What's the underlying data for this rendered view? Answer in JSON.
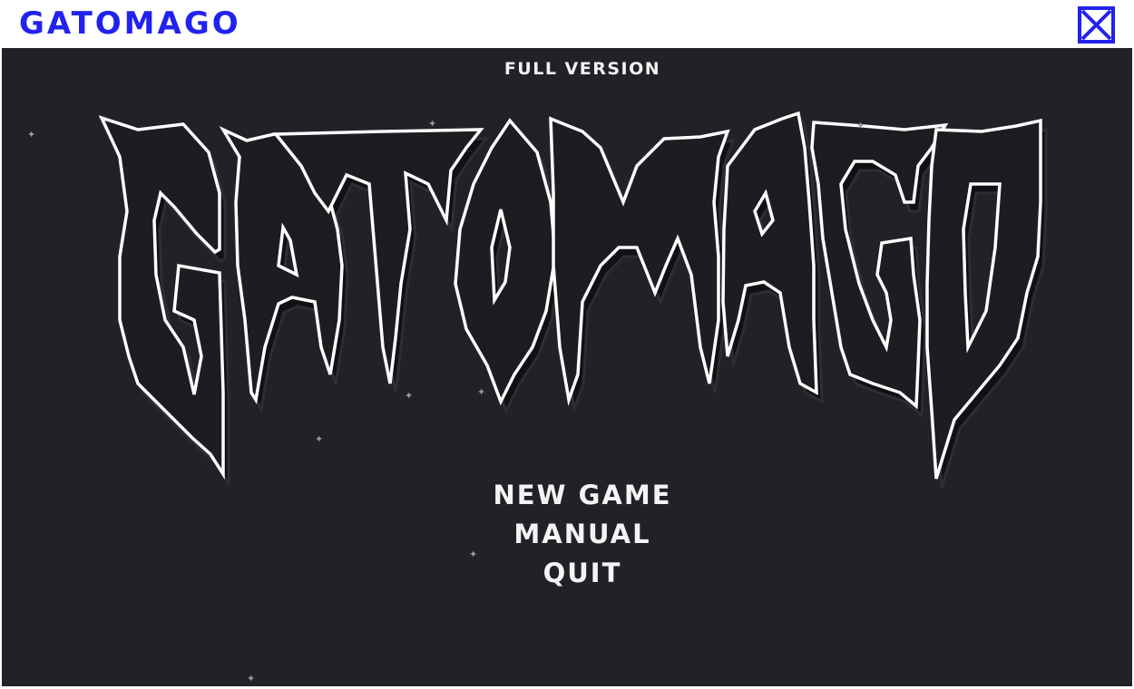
{
  "window": {
    "title": "GATOMAGO",
    "close_icon": "close-icon",
    "accent_color": "#2222ee"
  },
  "game": {
    "background_color": "#232127",
    "version_label": "FULL VERSION",
    "logo_text": "GATOMAGO",
    "menu": {
      "items": [
        {
          "label": "NEW GAME"
        },
        {
          "label": "MANUAL"
        },
        {
          "label": "QUIT"
        }
      ]
    },
    "decorations": {
      "sparkle_icon": "sparkle-icon"
    }
  }
}
